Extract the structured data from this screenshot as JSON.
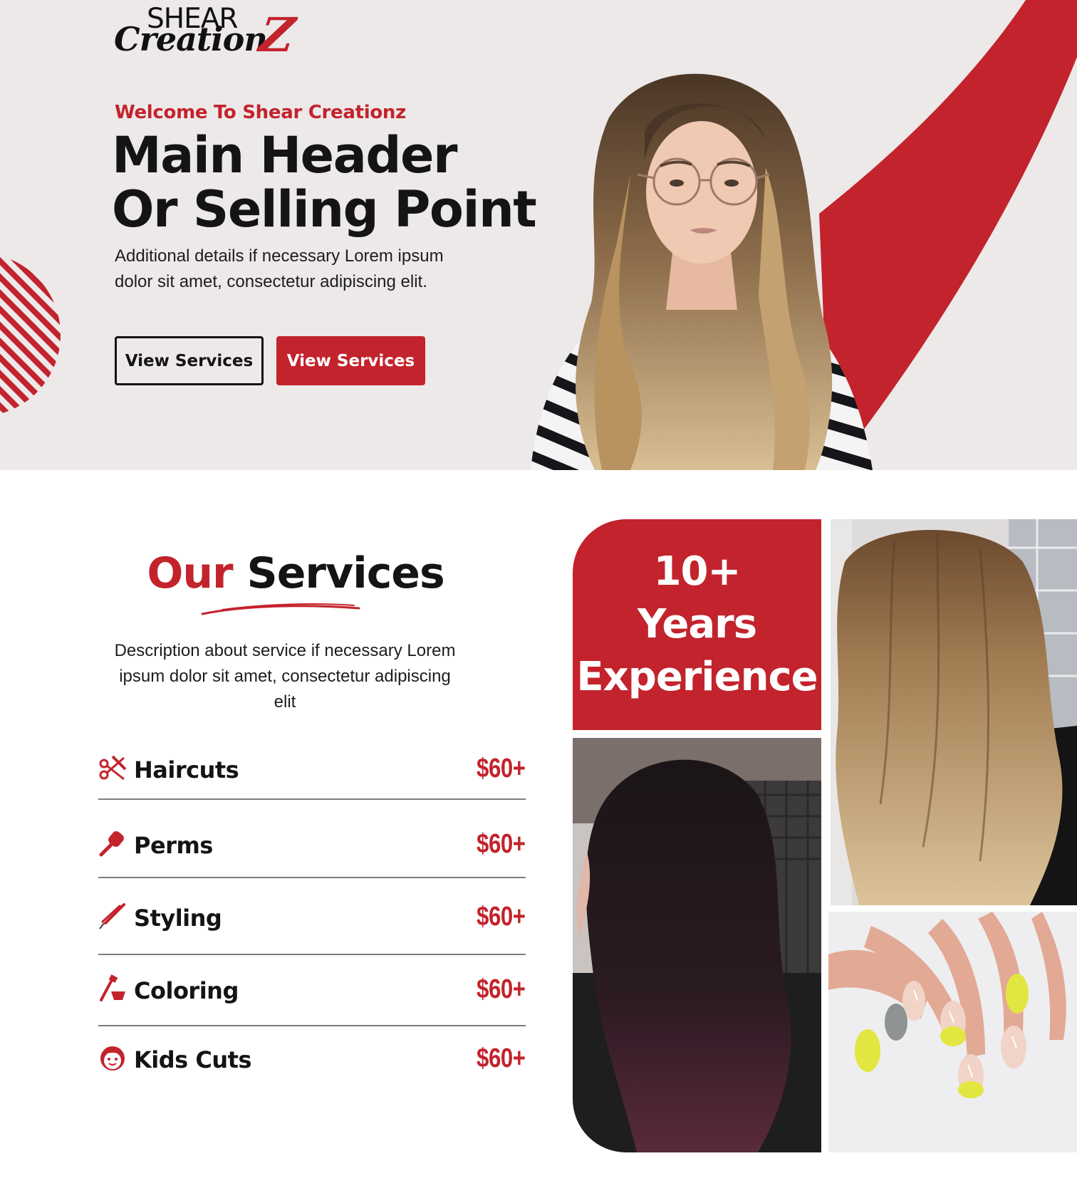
{
  "brand": {
    "logo_top": "SHEAR",
    "logo_bottom": "Creation",
    "logo_z": "Z",
    "accent_color": "#c3232c",
    "hero_bg": "#ede9e9"
  },
  "hero": {
    "welcome": "Welcome To Shear Creationz",
    "title_line1": "Main Header",
    "title_line2": "Or Selling Point",
    "description": "Additional details if necessary Lorem ipsum dolor sit amet, consectetur adipiscing elit.",
    "button_outline": "View Services",
    "button_solid": "View Services"
  },
  "services": {
    "title_red": "Our",
    "title_dark": "Services",
    "description": "Description about service if necessary Lorem ipsum dolor sit amet, consectetur adipiscing elit",
    "items": [
      {
        "name": "Haircuts",
        "price": "$60+",
        "icon": "scissors-comb-icon"
      },
      {
        "name": "Perms",
        "price": "$60+",
        "icon": "brush-icon"
      },
      {
        "name": "Styling",
        "price": "$60+",
        "icon": "flat-iron-icon"
      },
      {
        "name": "Coloring",
        "price": "$60+",
        "icon": "dye-bowl-icon"
      },
      {
        "name": "Kids Cuts",
        "price": "$60+",
        "icon": "kid-face-icon"
      }
    ]
  },
  "experience": {
    "line1": "10+",
    "line2": "Years",
    "line3": "Experience"
  }
}
